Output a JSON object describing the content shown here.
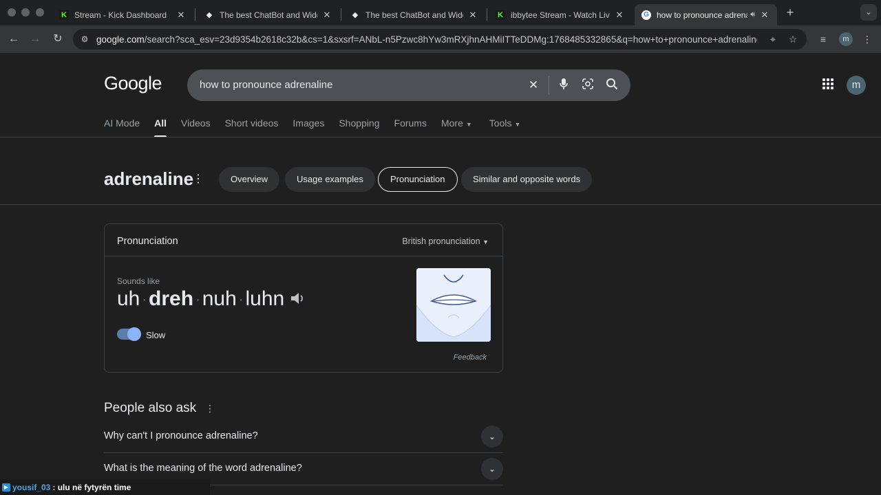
{
  "browser": {
    "tabs": [
      {
        "title": "Stream - Kick Dashboard",
        "favicon": "kick-icon",
        "color": "#53fc18"
      },
      {
        "title": "The best ChatBot and Widget",
        "favicon": "botrix-icon",
        "color": "#e8eaed"
      },
      {
        "title": "The best ChatBot and Widget",
        "favicon": "botrix-icon",
        "color": "#e8eaed"
      },
      {
        "title": "ibbytee Stream - Watch Live o",
        "favicon": "kick-icon",
        "color": "#53fc18"
      },
      {
        "title": "how to pronounce adrenaline",
        "favicon": "google-icon",
        "color": "#e8eaed"
      }
    ],
    "address": {
      "host": "google.com",
      "path": "/search?sca_esv=23d9354b2618c32b&cs=1&sxsrf=ANbL-n5Pzwc8hYw3mRXjhnAHMiITTeDDMg:1768485332865&q=how+to+pronounce+adrenaline..."
    },
    "profile_initial": "m"
  },
  "search": {
    "logo": "Google",
    "query": "how to pronounce adrenaline",
    "profile_initial": "m",
    "tabs": [
      {
        "label": "AI Mode",
        "selected": false
      },
      {
        "label": "All",
        "selected": true
      },
      {
        "label": "Videos",
        "selected": false
      },
      {
        "label": "Short videos",
        "selected": false
      },
      {
        "label": "Images",
        "selected": false
      },
      {
        "label": "Shopping",
        "selected": false
      },
      {
        "label": "Forums",
        "selected": false
      },
      {
        "label": "More",
        "selected": false
      },
      {
        "label": "Tools",
        "selected": false
      }
    ]
  },
  "entity": {
    "word": "adrenaline",
    "chips": [
      {
        "label": "Overview",
        "selected": false
      },
      {
        "label": "Usage examples",
        "selected": false
      },
      {
        "label": "Pronunciation",
        "selected": true
      },
      {
        "label": "Similar and opposite words",
        "selected": false
      }
    ]
  },
  "pronunciation": {
    "title": "Pronunciation",
    "dialect": "British pronunciation",
    "sounds_like_label": "Sounds like",
    "syllables": [
      "uh",
      "dreh",
      "nuh",
      "luhn"
    ],
    "stressed_index": 1,
    "slow_label": "Slow",
    "slow_enabled": true,
    "feedback": "Feedback"
  },
  "people_also_ask": {
    "title": "People also ask",
    "questions": [
      "Why can't I pronounce adrenaline?",
      "What is the meaning of the word adrenaline?"
    ]
  },
  "chat_overlay": {
    "user": "yousif_03",
    "message": ": ulu në fytyrën time"
  }
}
